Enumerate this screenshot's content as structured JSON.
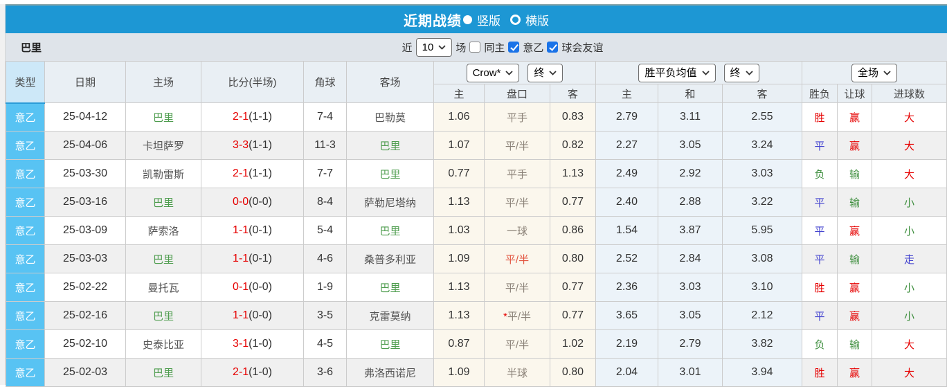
{
  "title_bar": {
    "title": "近期战绩",
    "vertical_label": "竖版",
    "horizontal_label": "横版",
    "selected_layout": "竖版"
  },
  "filter_bar": {
    "team": "巴里",
    "near_label": "近",
    "recent_count": "10",
    "matches_label": "场",
    "same_home_label": "同主",
    "same_home_checked": false,
    "league_label": "意乙",
    "league_checked": true,
    "friendly_label": "球会友谊",
    "friendly_checked": true
  },
  "table": {
    "controls": {
      "ah_company": "Crow*",
      "ah_time": "终",
      "eu_source": "胜平负均值",
      "eu_time": "终",
      "scope": "全场"
    },
    "headers": {
      "type": "类型",
      "date": "日期",
      "home": "主场",
      "score": "比分(半场)",
      "corner": "角球",
      "away": "客场",
      "ah_home": "主",
      "ah_line": "盘口",
      "ah_away": "客",
      "eu_home": "主",
      "eu_draw": "和",
      "eu_away": "客",
      "result": "胜负",
      "handicap": "让球",
      "goals": "进球数"
    },
    "rows": [
      {
        "type": "意乙",
        "date": "25-04-12",
        "home": "巴里",
        "home_active": true,
        "score": "2-1",
        "half": "(1-1)",
        "corner": "7-4",
        "away": "巴勒莫",
        "away_active": false,
        "ah_home": "1.06",
        "ah_star": false,
        "ah_line": "平手",
        "ah_line_red": false,
        "ah_away": "0.83",
        "eu_home": "2.79",
        "eu_draw": "3.11",
        "eu_away": "2.55",
        "result": "胜",
        "result_color": "red",
        "handicap": "赢",
        "handicap_color": "red",
        "goals": "大",
        "goals_color": "red"
      },
      {
        "type": "意乙",
        "date": "25-04-06",
        "home": "卡坦萨罗",
        "home_active": false,
        "score": "3-3",
        "half": "(1-1)",
        "corner": "11-3",
        "away": "巴里",
        "away_active": true,
        "ah_home": "1.07",
        "ah_star": false,
        "ah_line": "平/半",
        "ah_line_red": false,
        "ah_away": "0.82",
        "eu_home": "2.27",
        "eu_draw": "3.05",
        "eu_away": "3.24",
        "result": "平",
        "result_color": "blue",
        "handicap": "赢",
        "handicap_color": "red",
        "goals": "大",
        "goals_color": "red"
      },
      {
        "type": "意乙",
        "date": "25-03-30",
        "home": "凯勒雷斯",
        "home_active": false,
        "score": "2-1",
        "half": "(1-1)",
        "corner": "7-7",
        "away": "巴里",
        "away_active": true,
        "ah_home": "0.77",
        "ah_star": false,
        "ah_line": "平手",
        "ah_line_red": false,
        "ah_away": "1.13",
        "eu_home": "2.49",
        "eu_draw": "2.92",
        "eu_away": "3.03",
        "result": "负",
        "result_color": "green",
        "handicap": "输",
        "handicap_color": "green",
        "goals": "大",
        "goals_color": "red"
      },
      {
        "type": "意乙",
        "date": "25-03-16",
        "home": "巴里",
        "home_active": true,
        "score": "0-0",
        "half": "(0-0)",
        "corner": "8-4",
        "away": "萨勒尼塔纳",
        "away_active": false,
        "ah_home": "1.13",
        "ah_star": false,
        "ah_line": "平/半",
        "ah_line_red": false,
        "ah_away": "0.77",
        "eu_home": "2.40",
        "eu_draw": "2.88",
        "eu_away": "3.22",
        "result": "平",
        "result_color": "blue",
        "handicap": "输",
        "handicap_color": "green",
        "goals": "小",
        "goals_color": "green"
      },
      {
        "type": "意乙",
        "date": "25-03-09",
        "home": "萨索洛",
        "home_active": false,
        "score": "1-1",
        "half": "(0-1)",
        "corner": "5-4",
        "away": "巴里",
        "away_active": true,
        "ah_home": "1.03",
        "ah_star": false,
        "ah_line": "一球",
        "ah_line_red": false,
        "ah_away": "0.86",
        "eu_home": "1.54",
        "eu_draw": "3.87",
        "eu_away": "5.95",
        "result": "平",
        "result_color": "blue",
        "handicap": "赢",
        "handicap_color": "red",
        "goals": "小",
        "goals_color": "green"
      },
      {
        "type": "意乙",
        "date": "25-03-03",
        "home": "巴里",
        "home_active": true,
        "score": "1-1",
        "half": "(0-1)",
        "corner": "4-6",
        "away": "桑普多利亚",
        "away_active": false,
        "ah_home": "1.09",
        "ah_star": false,
        "ah_line": "平/半",
        "ah_line_red": true,
        "ah_away": "0.80",
        "eu_home": "2.52",
        "eu_draw": "2.84",
        "eu_away": "3.08",
        "result": "平",
        "result_color": "blue",
        "handicap": "输",
        "handicap_color": "green",
        "goals": "走",
        "goals_color": "blue"
      },
      {
        "type": "意乙",
        "date": "25-02-22",
        "home": "曼托瓦",
        "home_active": false,
        "score": "0-1",
        "half": "(0-0)",
        "corner": "1-9",
        "away": "巴里",
        "away_active": true,
        "ah_home": "1.13",
        "ah_star": false,
        "ah_line": "平/半",
        "ah_line_red": false,
        "ah_away": "0.77",
        "eu_home": "2.36",
        "eu_draw": "3.03",
        "eu_away": "3.10",
        "result": "胜",
        "result_color": "red",
        "handicap": "赢",
        "handicap_color": "red",
        "goals": "小",
        "goals_color": "green"
      },
      {
        "type": "意乙",
        "date": "25-02-16",
        "home": "巴里",
        "home_active": true,
        "score": "1-1",
        "half": "(0-0)",
        "corner": "3-5",
        "away": "克雷莫纳",
        "away_active": false,
        "ah_home": "1.13",
        "ah_star": true,
        "ah_line": "平/半",
        "ah_line_red": false,
        "ah_away": "0.77",
        "eu_home": "3.65",
        "eu_draw": "3.05",
        "eu_away": "2.12",
        "result": "平",
        "result_color": "blue",
        "handicap": "赢",
        "handicap_color": "red",
        "goals": "小",
        "goals_color": "green"
      },
      {
        "type": "意乙",
        "date": "25-02-10",
        "home": "史泰比亚",
        "home_active": false,
        "score": "3-1",
        "half": "(1-0)",
        "corner": "4-5",
        "away": "巴里",
        "away_active": true,
        "ah_home": "0.87",
        "ah_star": false,
        "ah_line": "平/半",
        "ah_line_red": false,
        "ah_away": "1.02",
        "eu_home": "2.19",
        "eu_draw": "2.79",
        "eu_away": "3.82",
        "result": "负",
        "result_color": "green",
        "handicap": "输",
        "handicap_color": "green",
        "goals": "大",
        "goals_color": "red"
      },
      {
        "type": "意乙",
        "date": "25-02-03",
        "home": "巴里",
        "home_active": true,
        "score": "2-1",
        "half": "(1-0)",
        "corner": "3-6",
        "away": "弗洛西诺尼",
        "away_active": false,
        "ah_home": "1.09",
        "ah_star": false,
        "ah_line": "半球",
        "ah_line_red": false,
        "ah_away": "0.80",
        "eu_home": "2.04",
        "eu_draw": "3.01",
        "eu_away": "3.94",
        "result": "胜",
        "result_color": "red",
        "handicap": "赢",
        "handicap_color": "red",
        "goals": "大",
        "goals_color": "red"
      }
    ]
  },
  "colors": {
    "topbar_blue": "#1d97d4",
    "type_cell_blue": "#58c3f3",
    "win_red": "#e60000",
    "draw_blue": "#4343cf",
    "lose_green": "#3f8f3f",
    "checkbox_blue": "#1a73e8",
    "ah_column_bg": "#fbf7ed",
    "eu_column_bg": "#ecf3f9"
  }
}
